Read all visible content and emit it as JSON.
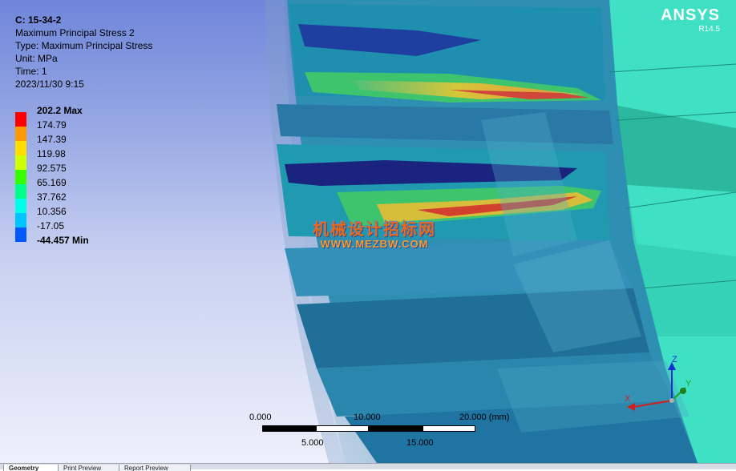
{
  "result_info": {
    "title": "C: 15-34-2",
    "name": "Maximum Principal Stress 2",
    "type": "Type: Maximum Principal Stress",
    "unit": "Unit: MPa",
    "time": "Time: 1",
    "date": "2023/11/30 9:15"
  },
  "legend": [
    {
      "label": "202.2 Max",
      "color": "#ff0000"
    },
    {
      "label": "174.79",
      "color": "#ff9900"
    },
    {
      "label": "147.39",
      "color": "#ffdd00"
    },
    {
      "label": "119.98",
      "color": "#cfff00"
    },
    {
      "label": "92.575",
      "color": "#38ff00"
    },
    {
      "label": "65.169",
      "color": "#00ff8a"
    },
    {
      "label": "37.762",
      "color": "#00ffe8"
    },
    {
      "label": "10.356",
      "color": "#00c4ff"
    },
    {
      "label": "-17.05",
      "color": "#0059ff"
    },
    {
      "label": "-44.457 Min",
      "color": "#0000ff"
    }
  ],
  "brand": {
    "name": "ANSYS",
    "version": "R14.5"
  },
  "watermark": {
    "text": "机械设计招标网",
    "url": "WWW.MEZBW.COM"
  },
  "scale_bar": {
    "top_labels": [
      "0.000",
      "10.000",
      "20.000 (mm)"
    ],
    "bottom_labels": [
      "5.000",
      "15.000"
    ]
  },
  "triad": {
    "z": "Z",
    "y": "Y",
    "x": "X"
  },
  "tabs": [
    "Geometry",
    "Print Preview",
    "Report Preview"
  ]
}
